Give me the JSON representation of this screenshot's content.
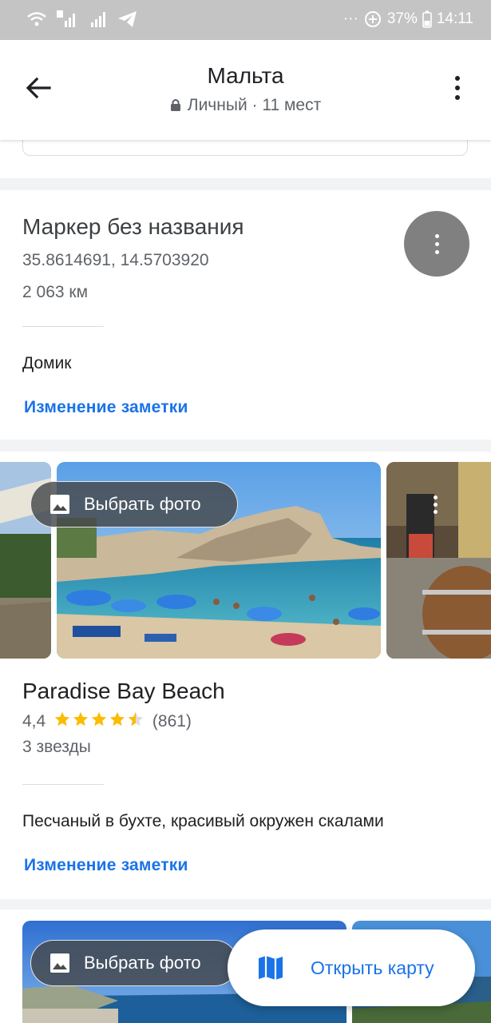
{
  "status_bar": {
    "battery_percent": "37%",
    "time": "14:11",
    "more": "···"
  },
  "header": {
    "title": "Мальта",
    "subtitle": "Личный · 11 мест"
  },
  "places": [
    {
      "name": "Маркер без названия",
      "coordinates": "35.8614691, 14.5703920",
      "distance": "2 063 км",
      "note": "Домик",
      "edit_label": "Изменение заметки"
    },
    {
      "name": "Paradise Bay Beach",
      "rating": "4,4",
      "rating_value": 4.4,
      "reviews": "(861)",
      "category": "3 звезды",
      "note": "Песчаный в бухте, красивый окружен скалами",
      "edit_label": "Изменение заметки",
      "choose_photo_label": "Выбрать фото"
    },
    {
      "choose_photo_label": "Выбрать фото"
    }
  ],
  "fab": {
    "label": "Открыть карту"
  },
  "colors": {
    "accent": "#1a73e8",
    "star": "#fbbc04",
    "status_bar": "#c4c4c4"
  }
}
